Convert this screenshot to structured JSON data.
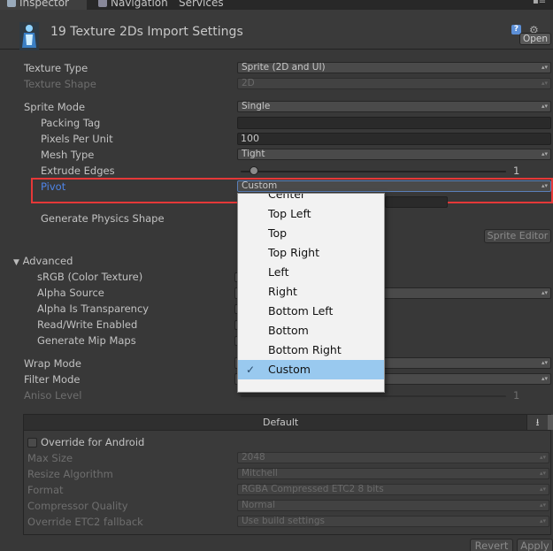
{
  "tabs": [
    {
      "label": "Inspector",
      "active": true
    },
    {
      "label": "Navigation",
      "active": false
    },
    {
      "label": "Services",
      "active": false
    }
  ],
  "header": {
    "title": "19 Texture 2Ds Import Settings",
    "open_label": "Open",
    "help_glyph": "?",
    "settings_glyph": "⚙"
  },
  "fields": {
    "texture_type": {
      "label": "Texture Type",
      "value": "Sprite (2D and UI)"
    },
    "texture_shape": {
      "label": "Texture Shape",
      "value": "2D"
    },
    "sprite_mode": {
      "label": "Sprite Mode",
      "value": "Single"
    },
    "packing_tag": {
      "label": "Packing Tag",
      "value": ""
    },
    "pixels_per_unit": {
      "label": "Pixels Per Unit",
      "value": "100"
    },
    "mesh_type": {
      "label": "Mesh Type",
      "value": "Tight"
    },
    "extrude_edges": {
      "label": "Extrude Edges",
      "value": "1",
      "fraction": 0.05
    },
    "pivot": {
      "label": "Pivot",
      "value": "Custom"
    },
    "generate_physics_shape": {
      "label": "Generate Physics Shape"
    },
    "sprite_editor_label": "Sprite Editor"
  },
  "advanced": {
    "label": "Advanced",
    "srgb": "sRGB (Color Texture)",
    "alpha_source": "Alpha Source",
    "alpha_is_transparency": "Alpha Is Transparency",
    "read_write": "Read/Write Enabled",
    "mip_maps": "Generate Mip Maps"
  },
  "wrap": {
    "wrap_mode": "Wrap Mode",
    "filter_mode": "Filter Mode",
    "aniso_level": {
      "label": "Aniso Level",
      "value": "1"
    }
  },
  "platform": {
    "default_label": "Default",
    "download_glyph": "⭳",
    "android_glyph": "▲"
  },
  "android": {
    "override_label": "Override for Android",
    "max_size": {
      "label": "Max Size",
      "value": "2048"
    },
    "resize_algorithm": {
      "label": "Resize Algorithm",
      "value": "Mitchell"
    },
    "format": {
      "label": "Format",
      "value": "RGBA Compressed ETC2 8 bits"
    },
    "compressor_quality": {
      "label": "Compressor Quality",
      "value": "Normal"
    },
    "etc2_fallback": {
      "label": "Override ETC2 fallback",
      "value": "Use build settings"
    }
  },
  "buttons": {
    "revert": "Revert",
    "apply": "Apply"
  },
  "pivot_dropdown": {
    "options": [
      "Center",
      "Top Left",
      "Top",
      "Top Right",
      "Left",
      "Right",
      "Bottom Left",
      "Bottom",
      "Bottom Right",
      "Custom"
    ],
    "selected": "Custom",
    "check_glyph": "✓"
  },
  "colors": {
    "accent_blue": "#4d84e6",
    "highlight_red": "#e53838",
    "selection": "#99c9ef"
  }
}
